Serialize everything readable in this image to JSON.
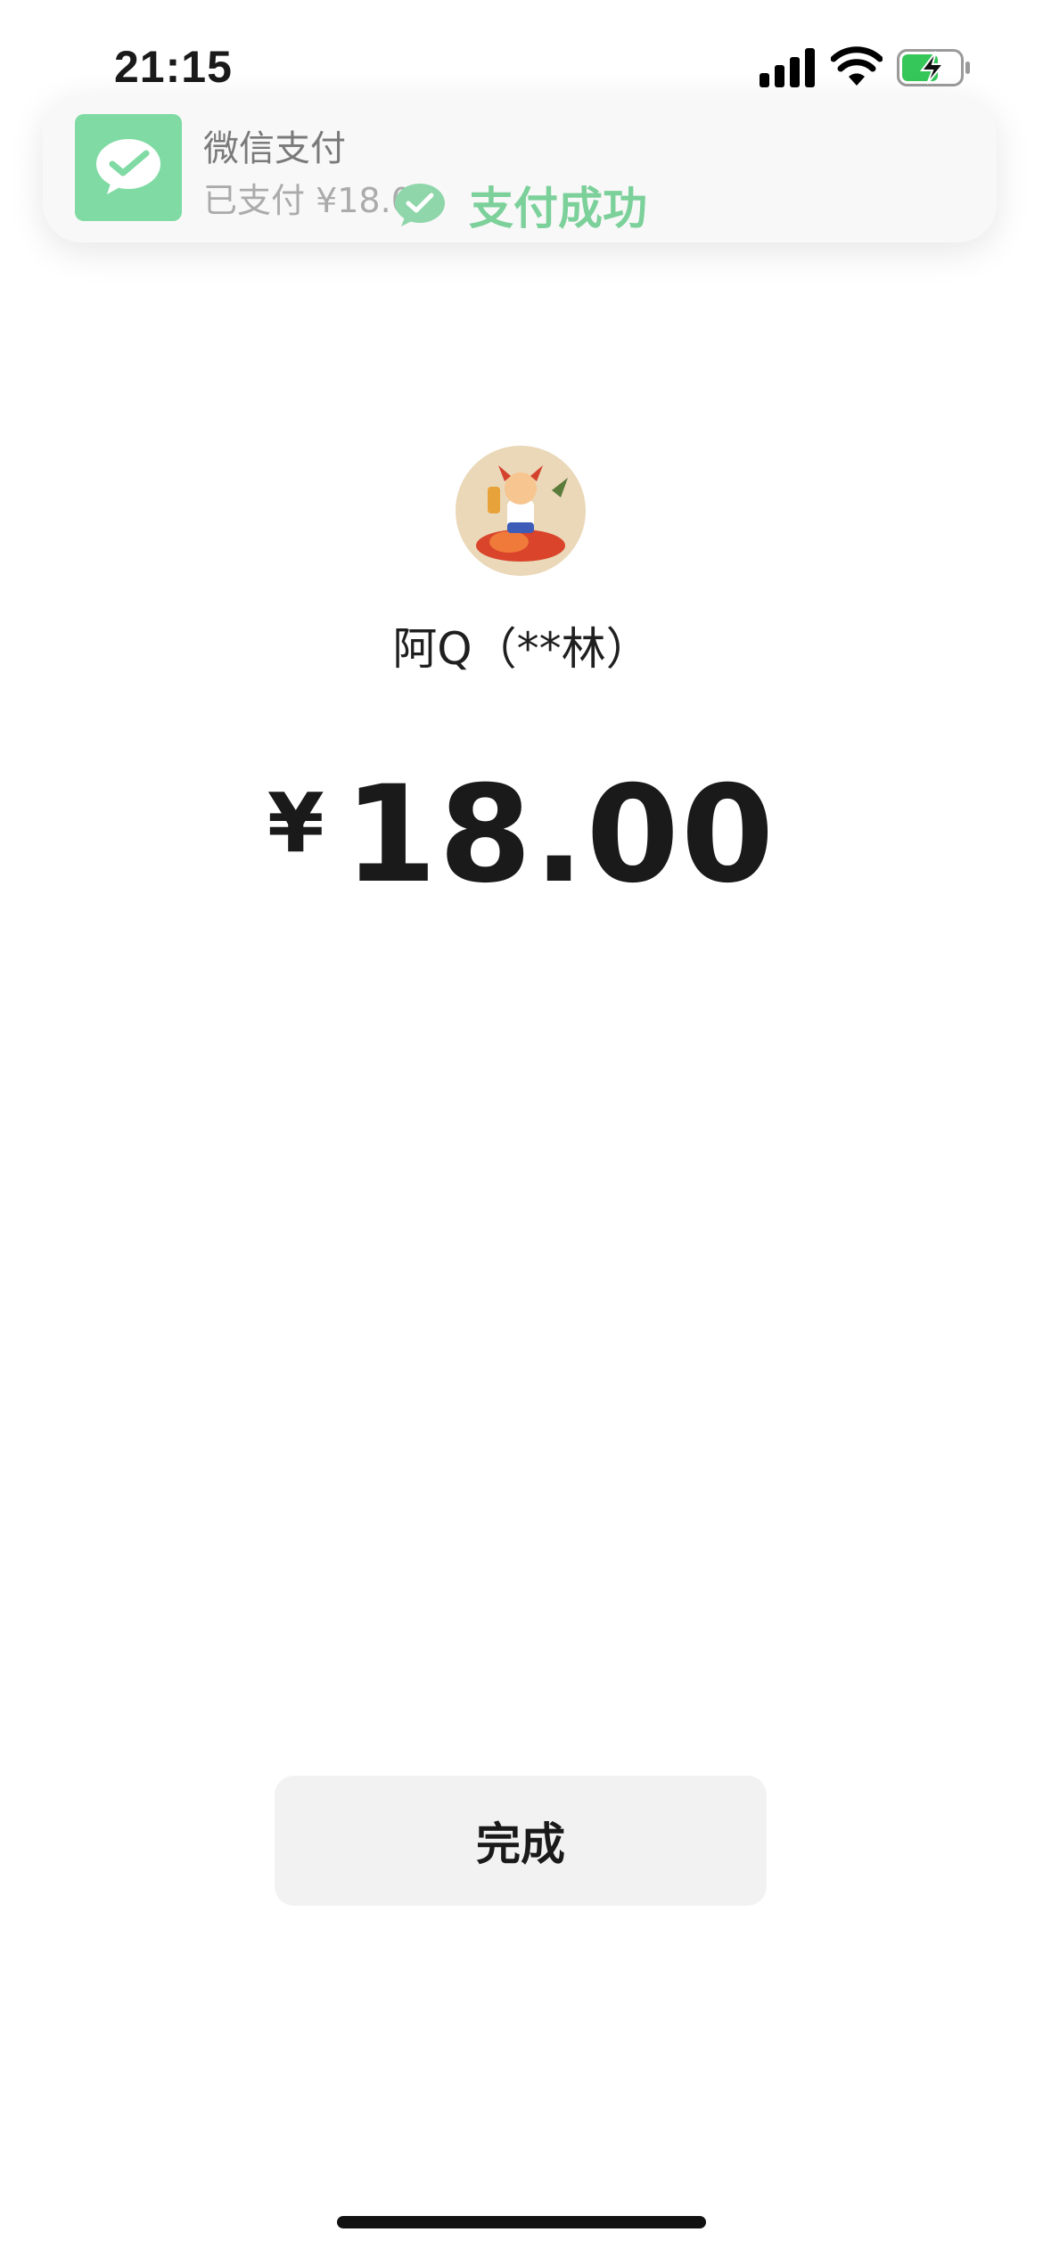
{
  "status_bar": {
    "time": "21:15",
    "signal_icon": "signal-icon",
    "wifi_icon": "wifi-icon",
    "battery_icon": "battery-charging-icon",
    "battery_color": "#35c759"
  },
  "notification": {
    "app_icon": "wechat-pay-icon",
    "app_name": "微信支付",
    "message": "已支付 ¥18.00",
    "success_icon": "check-bubble-icon",
    "success_text": "支付成功",
    "accent_color": "#7fdba3"
  },
  "payee": {
    "avatar_icon": "payee-avatar",
    "name": "阿Q（**林）"
  },
  "payment": {
    "currency_symbol": "¥",
    "amount": "18.00"
  },
  "actions": {
    "done_label": "完成"
  }
}
